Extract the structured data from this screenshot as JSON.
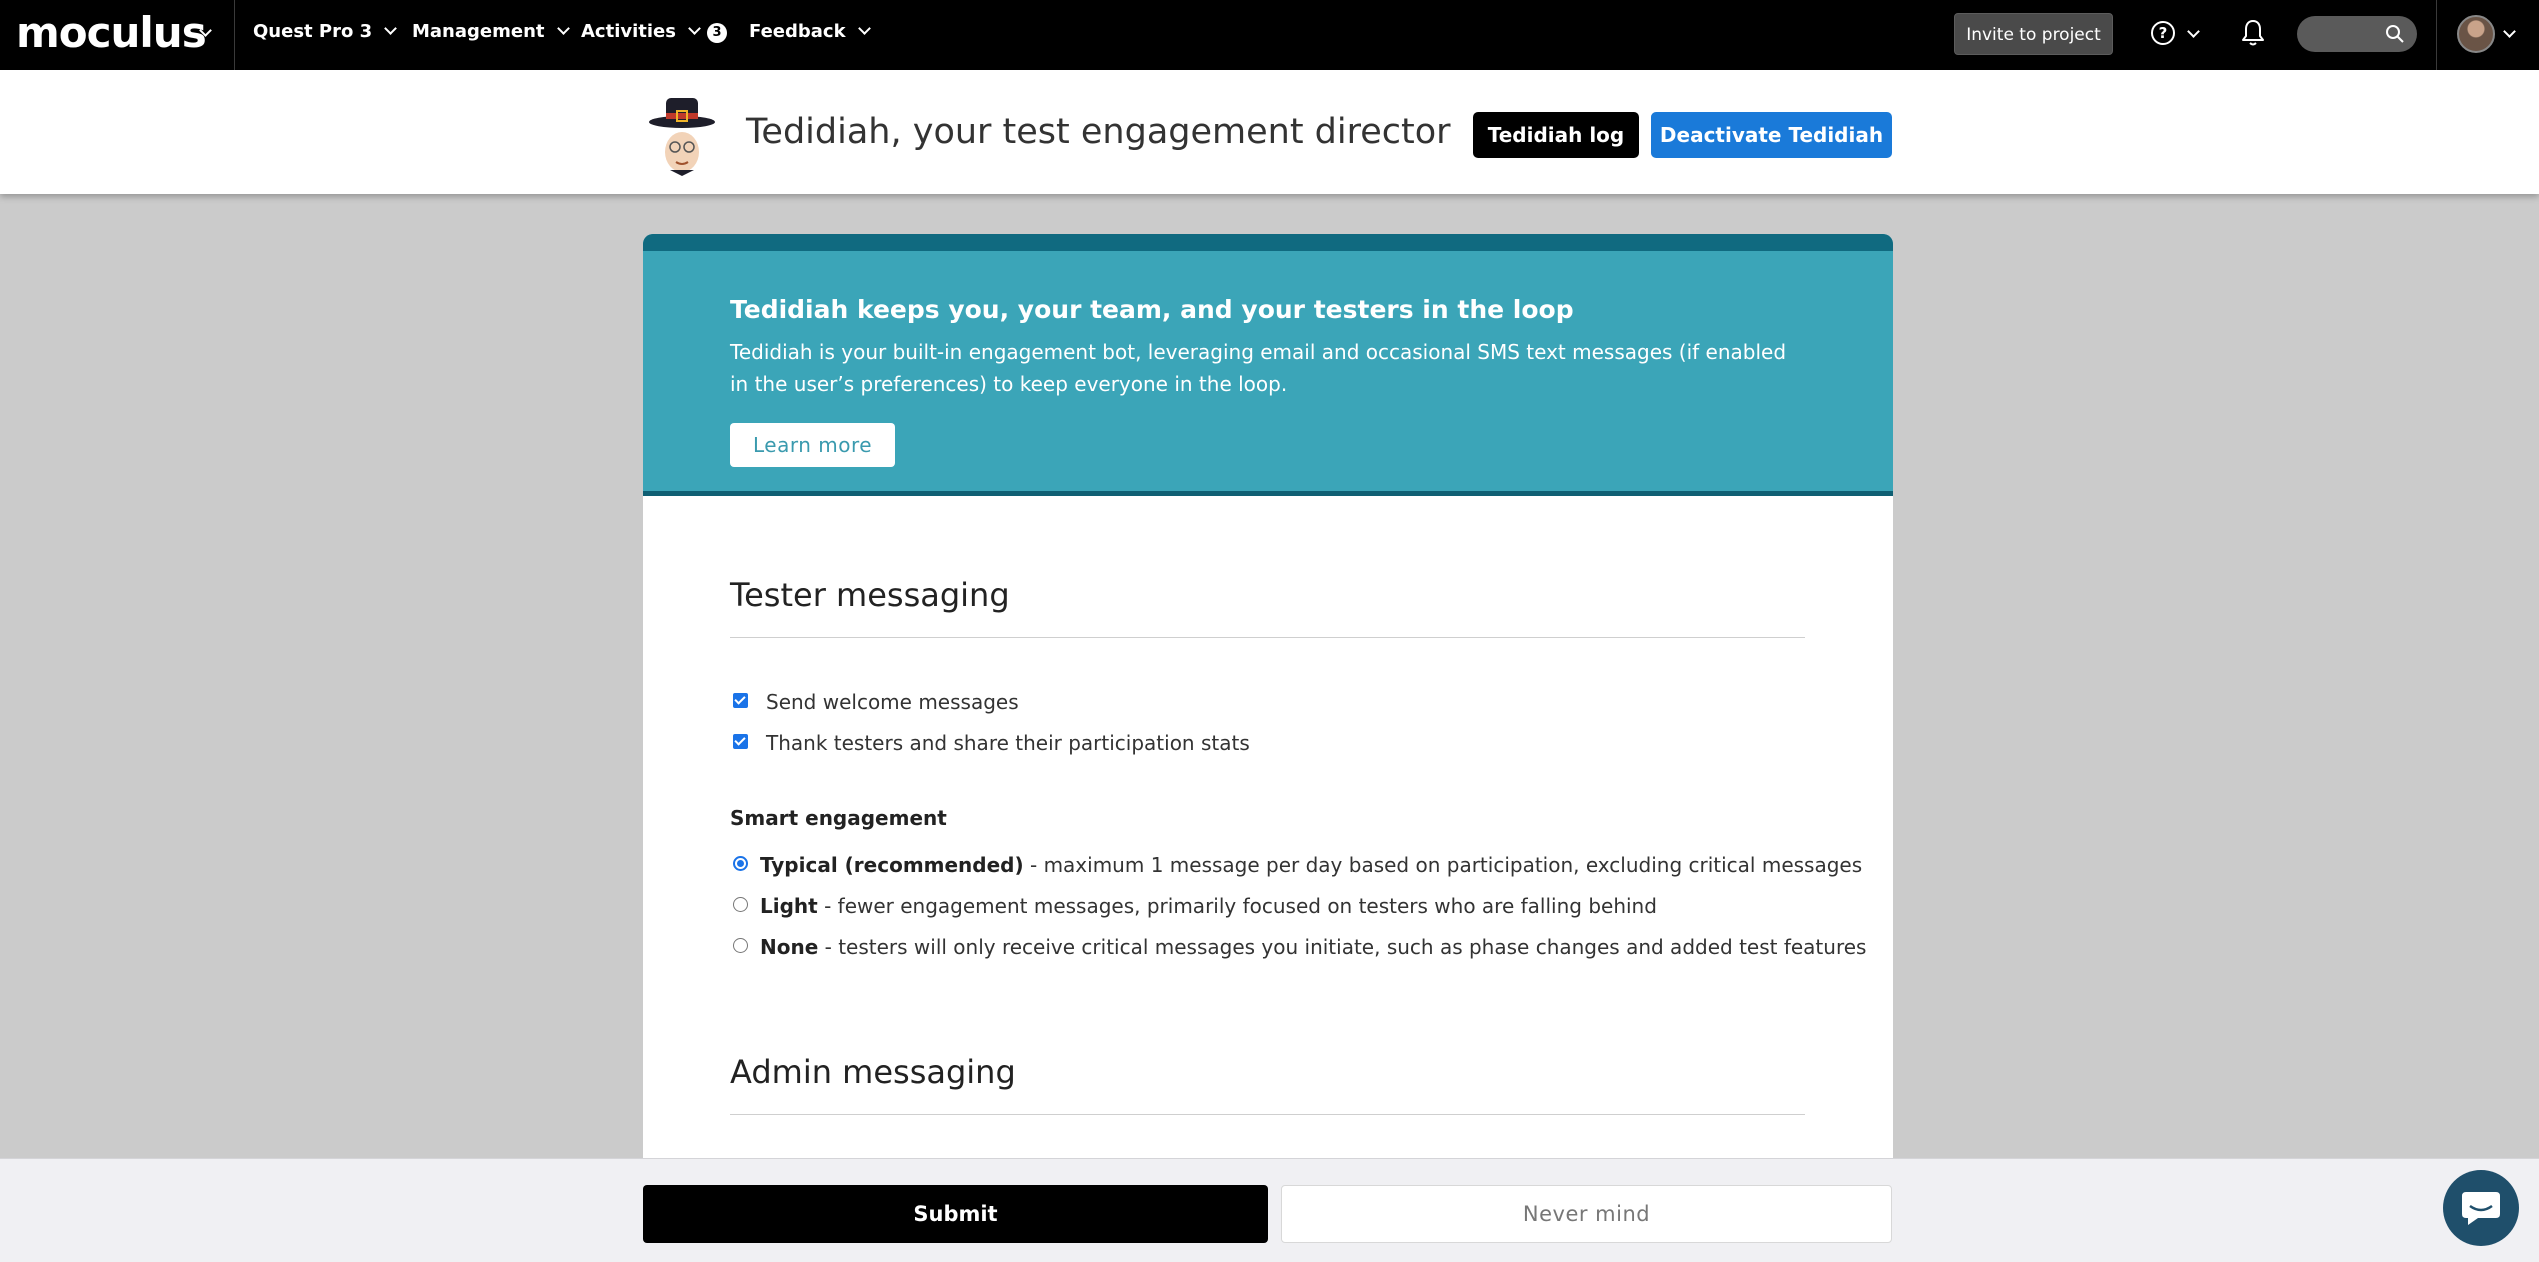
{
  "nav": {
    "logo": "moculus",
    "items": [
      {
        "label": "Quest Pro 3"
      },
      {
        "label": "Management"
      },
      {
        "label": "Activities",
        "badge": "3"
      },
      {
        "label": "Feedback"
      }
    ],
    "invite_label": "Invite to project",
    "help_glyph": "?",
    "icons": [
      "chevron-down-icon",
      "help-icon",
      "bell-icon",
      "search-icon",
      "avatar"
    ]
  },
  "header": {
    "title": "Tedidiah, your test engagement director",
    "log_button": "Tedidiah log",
    "deactivate_button": "Deactivate Tedidiah"
  },
  "banner": {
    "title": "Tedidiah keeps you, your team, and your testers in the loop",
    "text": "Tedidiah is your built-in engagement bot, leveraging email and occasional SMS text messages (if enabled in the user’s preferences) to keep everyone in the loop.",
    "learn_more": "Learn more"
  },
  "tester_messaging": {
    "title": "Tester messaging",
    "checkboxes": [
      {
        "label": "Send welcome messages",
        "checked": true
      },
      {
        "label": "Thank testers and share their participation stats",
        "checked": true
      }
    ],
    "smart_engagement": {
      "heading": "Smart engagement",
      "options": [
        {
          "name": "Typical (recommended)",
          "desc": " - maximum 1 message per day based on participation, excluding critical messages",
          "selected": true
        },
        {
          "name": "Light",
          "desc": " - fewer engagement messages, primarily focused on testers who are falling behind",
          "selected": false
        },
        {
          "name": "None",
          "desc": " - testers will only receive critical messages you initiate, such as phase changes and added test features",
          "selected": false
        }
      ]
    }
  },
  "admin_messaging": {
    "title": "Admin messaging"
  },
  "footer": {
    "submit": "Submit",
    "never_mind": "Never mind"
  },
  "colors": {
    "accent_blue": "#1a7ad9",
    "banner_teal": "#3ba5b8",
    "banner_dark": "#106a80",
    "nav_black": "#000000"
  }
}
